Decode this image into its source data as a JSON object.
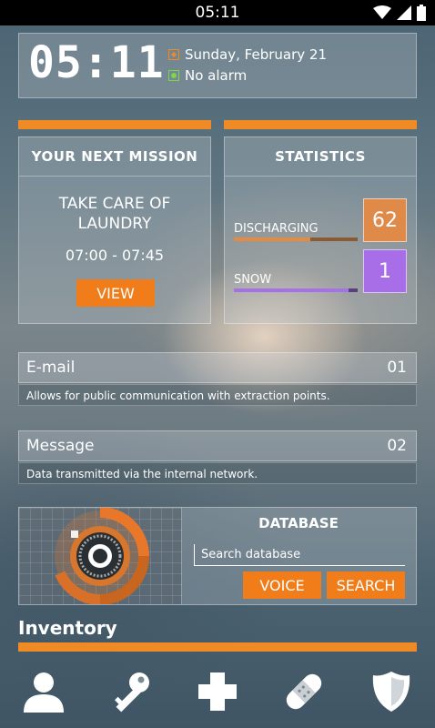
{
  "status_bar": {
    "time": "05:11"
  },
  "clock": {
    "time": "05:11",
    "date": "Sunday, February 21",
    "alarm": "No alarm",
    "date_icon_color": "#f08a24",
    "alarm_icon_color": "#7cd64a"
  },
  "mission": {
    "header": "YOUR NEXT MISSION",
    "title_line1": "TAKE CARE OF",
    "title_line2": "LAUNDRY",
    "time_range": "07:00 - 07:45",
    "view_label": "VIEW"
  },
  "statistics": {
    "header": "STATISTICS",
    "items": [
      {
        "label": "DISCHARGING",
        "value": "62",
        "fraction": 0.62,
        "color": "#e88a3e"
      },
      {
        "label": "SNOW",
        "value": "1",
        "fraction": 0.93,
        "color": "#a670e6"
      }
    ]
  },
  "rows": [
    {
      "title": "E-mail",
      "number": "01",
      "description": "Allows for public communication with extraction points."
    },
    {
      "title": "Message",
      "number": "02",
      "description": "Data transmitted via the internal network."
    }
  ],
  "database": {
    "title": "DATABASE",
    "search_placeholder": "Search database",
    "voice_label": "VOICE",
    "search_label": "SEARCH"
  },
  "inventory": {
    "title": "Inventory"
  },
  "nav_icons": [
    "person-icon",
    "key-icon",
    "cross-icon",
    "bandage-icon",
    "shield-icon"
  ],
  "accent_color": "#f08a24"
}
